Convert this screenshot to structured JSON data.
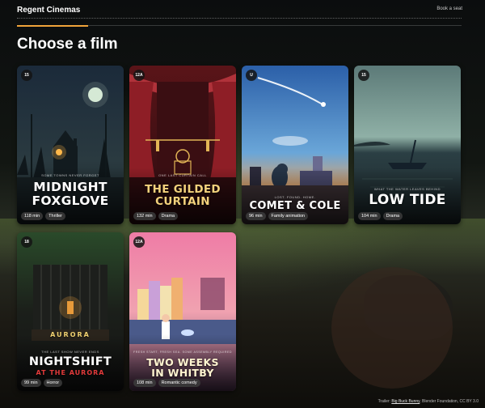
{
  "app": {
    "brand": "Regent Cinemas",
    "book_link": "Book a seat"
  },
  "progress": {
    "fraction": 0.16
  },
  "page_title": "Choose a film",
  "films": [
    {
      "rating": "15",
      "tagline": "SOME TOWNS NEVER FORGET",
      "title_line1": "MIDNIGHT",
      "title_line2": "FOXGLOVE",
      "runtime": "118 min",
      "genre": "Thriller"
    },
    {
      "rating": "12A",
      "tagline": "ONE LAST CURTAIN CALL",
      "title_line1": "THE GILDED",
      "title_line2": "CURTAIN",
      "runtime": "132 min",
      "genre": "Drama"
    },
    {
      "rating": "U",
      "tagline": "LOST. FOUND. HOME.",
      "title_line1": "COMET & COLE",
      "title_line2": "",
      "runtime": "96 min",
      "genre": "Family animation"
    },
    {
      "rating": "15",
      "tagline": "WHAT THE WATER LEAVES BEHIND",
      "title_line1": "LOW TIDE",
      "title_line2": "",
      "runtime": "104 min",
      "genre": "Drama"
    },
    {
      "rating": "18",
      "tagline": "THE LAST SHOW NEVER ENDS",
      "marquee": "AURORA",
      "title_line1": "NIGHTSHIFT",
      "title_line2": "AT THE AURORA",
      "runtime": "99 min",
      "genre": "Horror"
    },
    {
      "rating": "12A",
      "tagline": "FRESH START, FRESH SEA. SOME ASSEMBLY REQUIRED",
      "title_line1": "TWO WEEKS",
      "title_line2": "IN WHITBY",
      "runtime": "108 min",
      "genre": "Romantic comedy"
    }
  ],
  "footer": {
    "prefix": "Trailer:",
    "link": "Big Buck Bunny",
    "suffix": ", Blender Foundation, CC BY 3.0"
  },
  "colors": {
    "accent": "#f0a33a",
    "background": "#0d0f10"
  }
}
